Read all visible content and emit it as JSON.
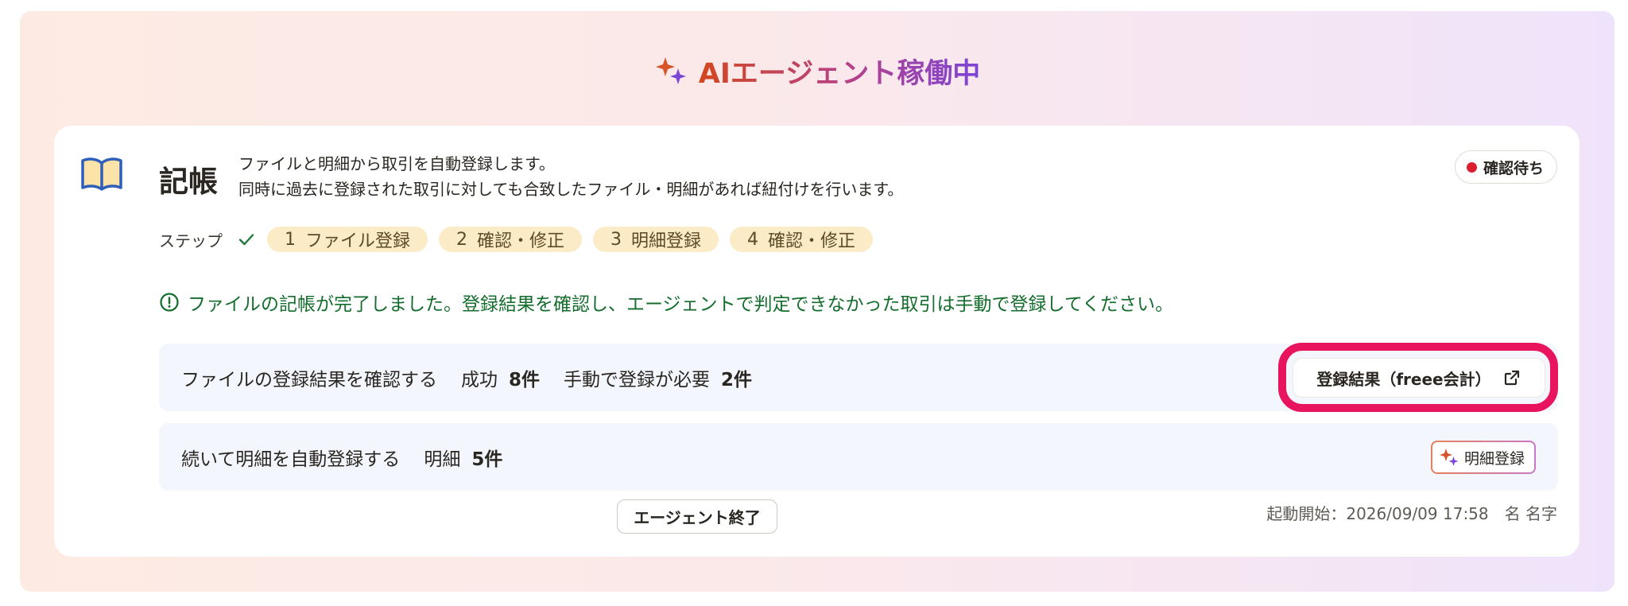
{
  "agent_header": {
    "title": "AIエージェント稼働中",
    "icon": "sparkle-icon"
  },
  "card": {
    "icon": "book-open-icon",
    "title": "記帳",
    "description_lines": [
      "ファイルと明細から取引を自動登録します。",
      "同時に過去に登録された取引に対しても合致したファイル・明細があれば紐付けを行います。"
    ],
    "status_badge": "確認待ち"
  },
  "steps": {
    "label": "ステップ",
    "items": [
      {
        "number": "1",
        "label": "ファイル登録"
      },
      {
        "number": "2",
        "label": "確認・修正"
      },
      {
        "number": "3",
        "label": "明細登録"
      },
      {
        "number": "4",
        "label": "確認・修正"
      }
    ]
  },
  "notice": {
    "icon": "info-circle-icon",
    "text": "ファイルの記帳が完了しました。登録結果を確認し、エージェントで判定できなかった取引は手動で登録してください。"
  },
  "file_result_row": {
    "text": "ファイルの登録結果を確認する",
    "success_label": "成功",
    "success_count": "8件",
    "manual_label": "手動で登録が必要",
    "manual_count": "2件",
    "button_label": "登録結果（freee会計）"
  },
  "statement_row": {
    "text": "続いて明細を自動登録する",
    "detail_label": "明細",
    "detail_count": "5件",
    "button_label": "明細登録"
  },
  "footer": {
    "end_button_label": "エージェント終了",
    "started_at": "起動開始：2026/09/09 17:58",
    "user_name": "名 名字"
  },
  "colors": {
    "highlight": "#e8145d",
    "status_dot": "#dc1f2e",
    "notice_text": "#146d2d",
    "step_pill_bg": "#fcebc7"
  }
}
